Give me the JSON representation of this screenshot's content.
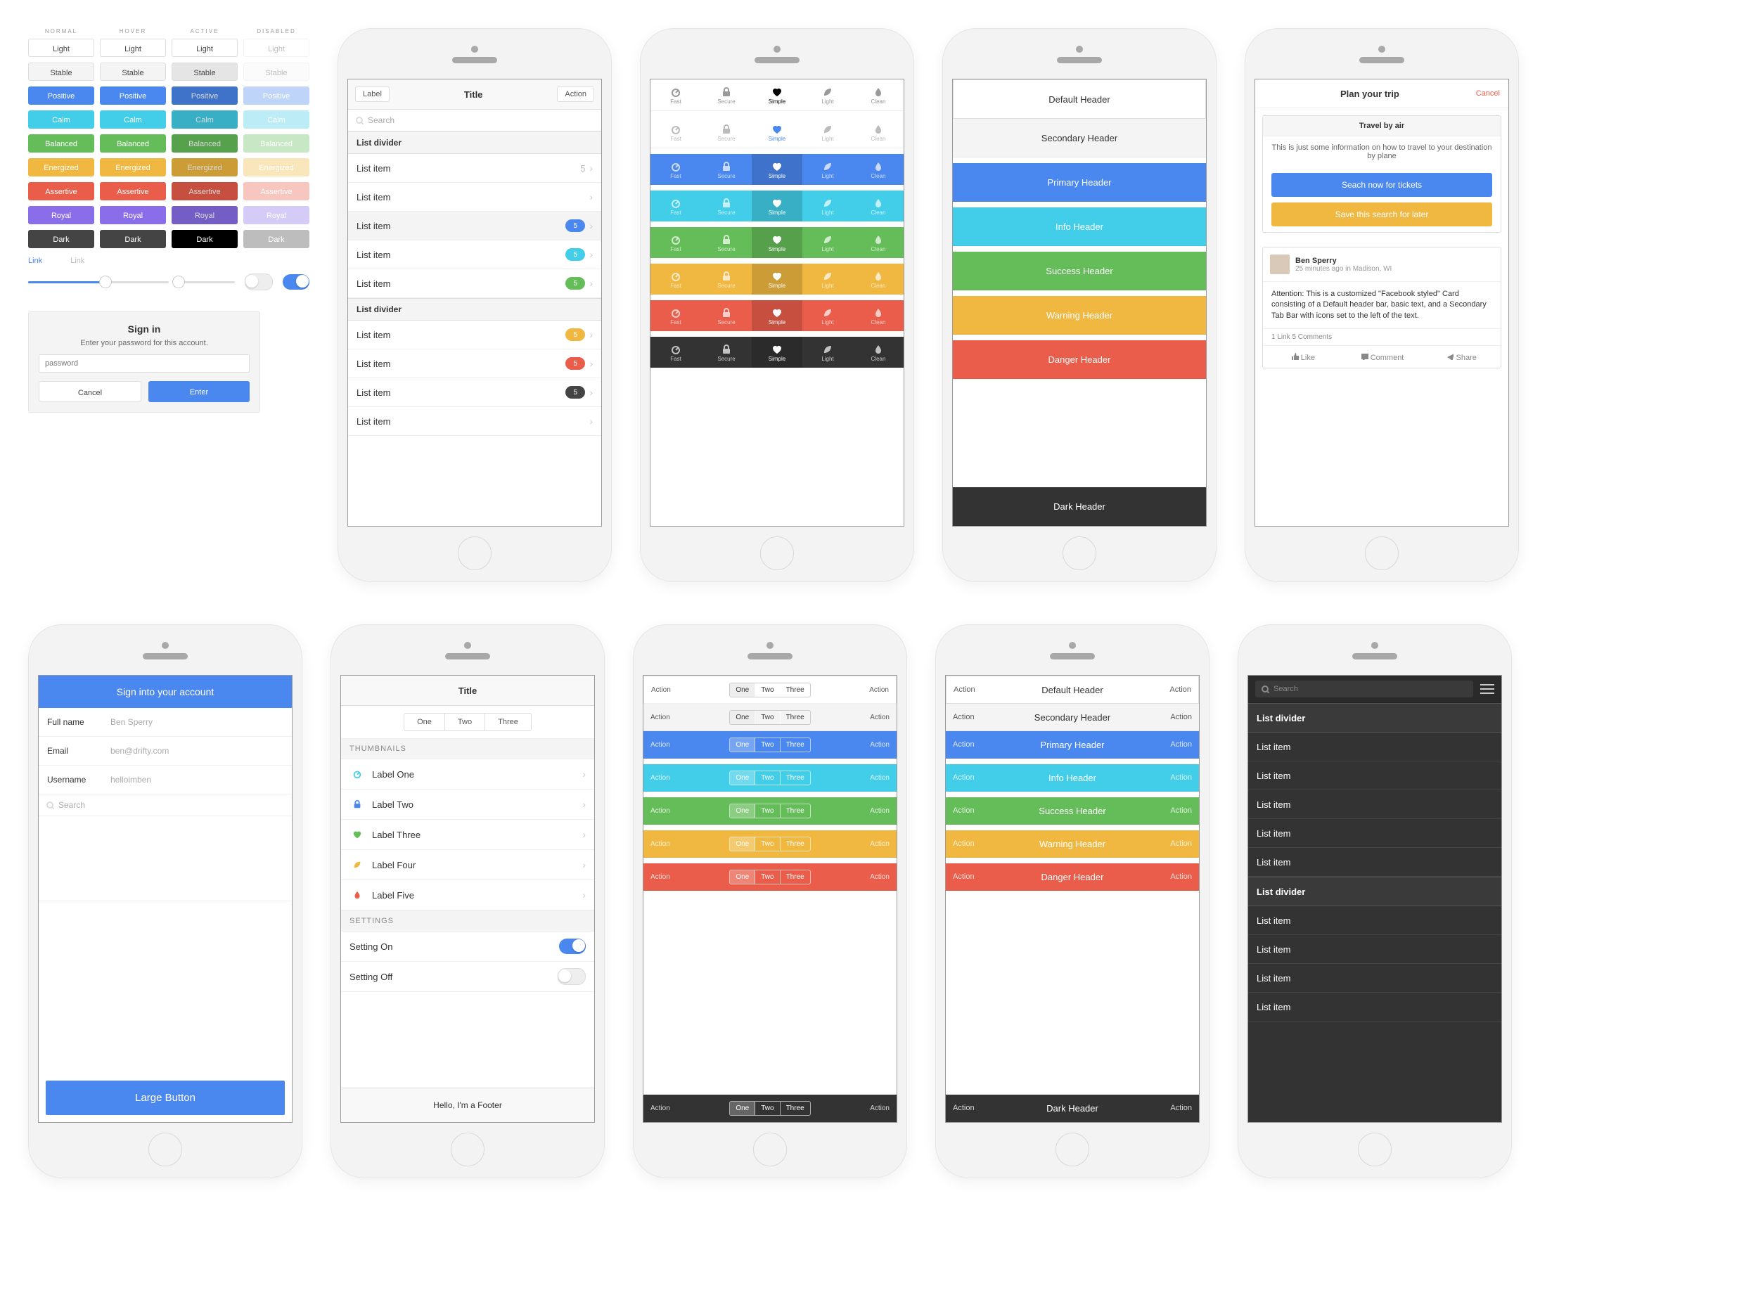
{
  "palette": {
    "states": [
      "Normal",
      "Hover",
      "Active",
      "Disabled"
    ],
    "rows": [
      {
        "key": "light",
        "label": "Light"
      },
      {
        "key": "stable",
        "label": "Stable"
      },
      {
        "key": "positive",
        "label": "Positive"
      },
      {
        "key": "calm",
        "label": "Calm"
      },
      {
        "key": "balanced",
        "label": "Balanced"
      },
      {
        "key": "energized",
        "label": "Energized"
      },
      {
        "key": "assertive",
        "label": "Assertive"
      },
      {
        "key": "royal",
        "label": "Royal"
      },
      {
        "key": "dark",
        "label": "Dark"
      }
    ],
    "link_text": "Link"
  },
  "signin": {
    "title": "Sign in",
    "subtitle": "Enter your password for this account.",
    "placeholder": "password",
    "cancel": "Cancel",
    "enter": "Enter"
  },
  "phone_list": {
    "nav_left": "Label",
    "title": "Title",
    "nav_right": "Action",
    "search_placeholder": "Search",
    "dividers": [
      "List divider",
      "List divider"
    ],
    "items": [
      {
        "label": "List item",
        "badge": "5",
        "color": "gray"
      },
      {
        "label": "List item"
      },
      {
        "label": "List item",
        "badge": "5",
        "color": "blue"
      },
      {
        "label": "List item",
        "badge": "5",
        "color": "teal"
      },
      {
        "label": "List item",
        "badge": "5",
        "color": "green"
      },
      {
        "label": "List item",
        "badge": "5",
        "color": "amber"
      },
      {
        "label": "List item",
        "badge": "5",
        "color": "red"
      },
      {
        "label": "List item",
        "badge": "5",
        "color": "dark"
      },
      {
        "label": "List item"
      }
    ]
  },
  "tabs": {
    "labels": [
      "Fast",
      "Secure",
      "Simple",
      "Light",
      "Clean"
    ]
  },
  "headers": {
    "default": "Default Header",
    "secondary": "Secondary Header",
    "primary": "Primary Header",
    "info": "Info Header",
    "success": "Success Header",
    "warning": "Warning Header",
    "danger": "Danger Header",
    "dark": "Dark Header",
    "action": "Action"
  },
  "trip": {
    "title": "Plan your trip",
    "cancel": "Cancel",
    "card1_title": "Travel by air",
    "card1_text": "This is just some information on how to travel to your destination by plane",
    "btn_search": "Seach now for tickets",
    "btn_save": "Save this search for later",
    "fb_name": "Ben Sperry",
    "fb_meta": "25 minutes ago in Madison, WI",
    "fb_body": "Attention: This is a customized \"Facebook styled\" Card consisting of a Default header bar, basic text, and a Secondary Tab Bar with icons set to the left of the text.",
    "fb_counts": "1 Link   5 Comments",
    "fb_like": "Like",
    "fb_comment": "Comment",
    "fb_share": "Share"
  },
  "form_phone": {
    "header": "Sign into your account",
    "rows": [
      {
        "label": "Full name",
        "value": "Ben Sperry"
      },
      {
        "label": "Email",
        "value": "ben@drifty.com"
      },
      {
        "label": "Username",
        "value": "helloimben"
      }
    ],
    "search": "Search",
    "large_button": "Large Button"
  },
  "thumbs_phone": {
    "title": "Title",
    "tabs": [
      "One",
      "Two",
      "Three"
    ],
    "section1": "THUMBNAILS",
    "items": [
      {
        "label": "Label One",
        "color": "#42CEE8"
      },
      {
        "label": "Label Two",
        "color": "#4A87EE"
      },
      {
        "label": "Label Three",
        "color": "#65BD59"
      },
      {
        "label": "Label Four",
        "color": "#F0B840"
      },
      {
        "label": "Label Five",
        "color": "#EA5D4A"
      }
    ],
    "section2": "SETTINGS",
    "setting_on": "Setting On",
    "setting_off": "Setting Off",
    "footer": "Hello, I'm a Footer"
  },
  "seg_phone": {
    "action": "Action",
    "tabs": [
      "One",
      "Two",
      "Three"
    ]
  },
  "dark_phone": {
    "search": "Search",
    "dividers": [
      "List divider",
      "List divider"
    ],
    "item": "List item"
  }
}
